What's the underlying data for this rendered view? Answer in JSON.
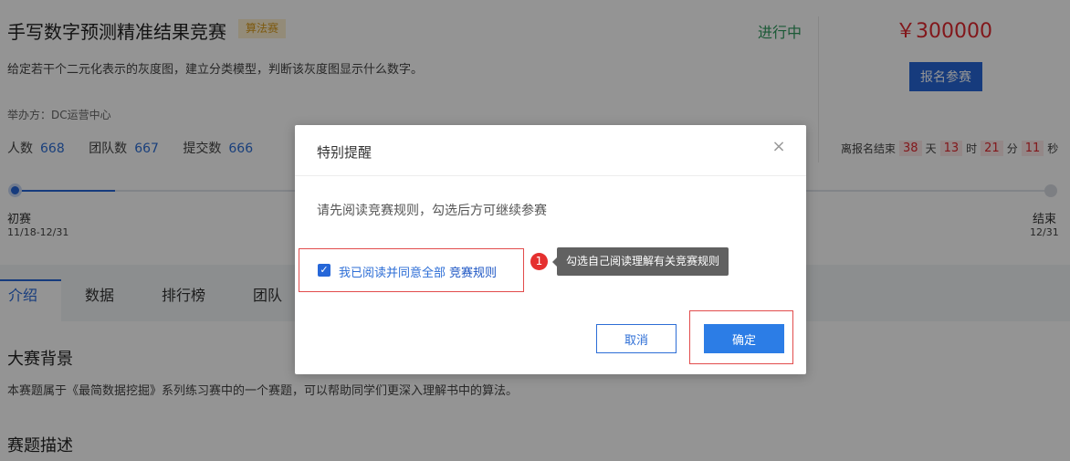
{
  "competition": {
    "title": "手写数字预测精准结果竞赛",
    "tag": "算法赛",
    "status": "进行中",
    "description": "给定若干个二元化表示的灰度图，建立分类模型，判断该灰度图显示什么数字。",
    "organizer": "举办方：DC运营中心",
    "stats": [
      {
        "label": "人数",
        "value": "668"
      },
      {
        "label": "团队数",
        "value": "667"
      },
      {
        "label": "提交数",
        "value": "666"
      }
    ],
    "prize": "￥300000",
    "signup_label": "报名参赛",
    "countdown": {
      "prefix": "离报名结束",
      "days": "38",
      "days_unit": "天",
      "hours": "13",
      "hours_unit": "时",
      "minutes": "21",
      "minutes_unit": "分",
      "seconds": "11",
      "seconds_unit": "秒"
    },
    "timeline": {
      "start_label": "初赛",
      "start_date": "11/18-12/31",
      "end_label": "结束",
      "end_date": "12/31"
    }
  },
  "tabs": [
    {
      "label": "介绍",
      "active": true
    },
    {
      "label": "数据"
    },
    {
      "label": "排行榜"
    },
    {
      "label": "团队"
    }
  ],
  "content": {
    "section1_title": "大赛背景",
    "section1_text": "本赛题属于《最简数据挖掘》系列练习赛中的一个赛题，可以帮助同学们更深入理解书中的算法。",
    "section2_title": "赛题描述"
  },
  "modal": {
    "title": "特别提醒",
    "close_icon": "×",
    "message": "请先阅读竞赛规则，勾选后方可继续参赛",
    "agree_text": "我已阅读并同意全部",
    "agree_link": "竞赛规则",
    "checked": true,
    "check_glyph": "✓",
    "cancel_label": "取消",
    "confirm_label": "确定"
  },
  "annotation": {
    "step": "1",
    "tooltip": "勾选自己阅读理解有关竞赛规则"
  }
}
